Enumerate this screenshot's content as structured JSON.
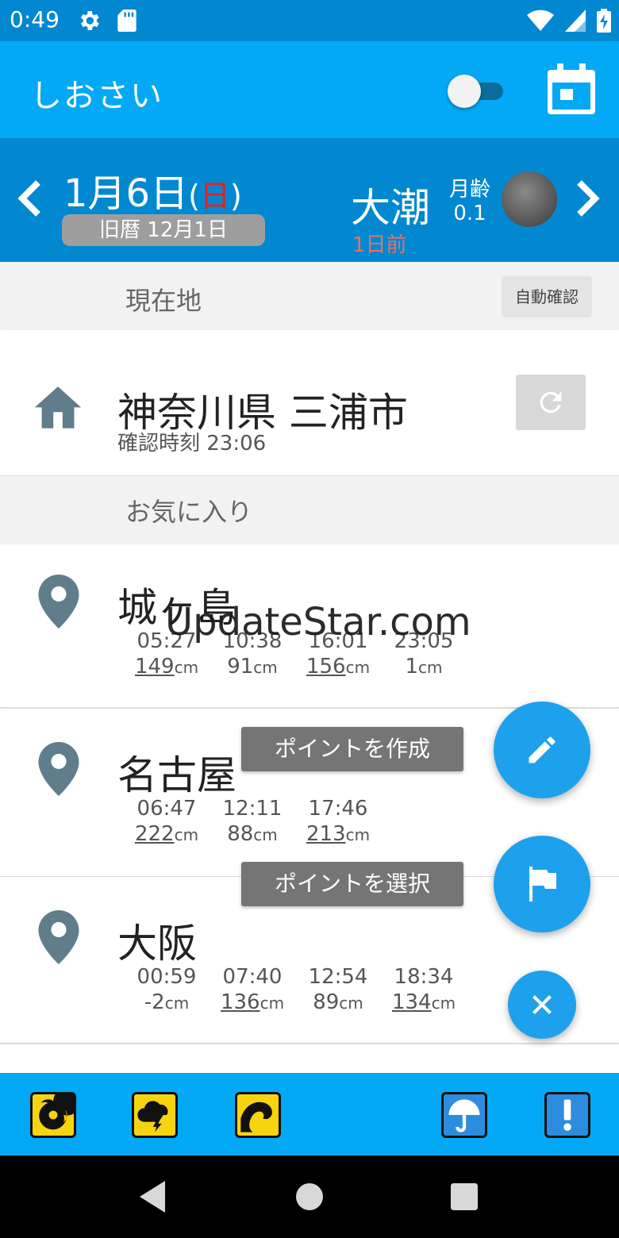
{
  "status_bar": {
    "time": "0:49"
  },
  "app_bar": {
    "title": "しおさい"
  },
  "date_bar": {
    "date": "1月6日",
    "paren_open": "(",
    "weekday": "日",
    "paren_close": ")",
    "old_calendar": "旧暦 12月1日",
    "tide_type": "大潮",
    "moon_age_label": "月齢",
    "moon_age_value": "0.1",
    "days_before": "1日前",
    "weekday_color": "#e82020"
  },
  "current_location": {
    "header": "現在地",
    "auto_button": "自動確認",
    "place": "神奈川県 三浦市",
    "checked_time": "確認時刻 23:06"
  },
  "favorites": {
    "header": "お気に入り",
    "items": [
      {
        "name": "城ヶ島",
        "tides": [
          {
            "time": "05:27",
            "height": "149",
            "unit": "cm"
          },
          {
            "time": "10:38",
            "height": "91",
            "unit": "cm"
          },
          {
            "time": "16:01",
            "height": "156",
            "unit": "cm"
          },
          {
            "time": "23:05",
            "height": "1",
            "unit": "cm"
          }
        ]
      },
      {
        "name": "名古屋",
        "tides": [
          {
            "time": "06:47",
            "height": "222",
            "unit": "cm"
          },
          {
            "time": "12:11",
            "height": "88",
            "unit": "cm"
          },
          {
            "time": "17:46",
            "height": "213",
            "unit": "cm"
          }
        ]
      },
      {
        "name": "大阪",
        "tides": [
          {
            "time": "00:59",
            "height": "-2",
            "unit": "cm"
          },
          {
            "time": "07:40",
            "height": "136",
            "unit": "cm"
          },
          {
            "time": "12:54",
            "height": "89",
            "unit": "cm"
          },
          {
            "time": "18:34",
            "height": "134",
            "unit": "cm"
          }
        ]
      }
    ]
  },
  "fab_menu": {
    "create_point": "ポイントを作成",
    "select_point": "ポイントを選択"
  },
  "watermark": "UpdateStar.com",
  "colors": {
    "status_bar": "#0288d1",
    "app_bar": "#03a9f4",
    "fab": "#1ea1ec",
    "tool_yellow": "#f7d40f"
  }
}
